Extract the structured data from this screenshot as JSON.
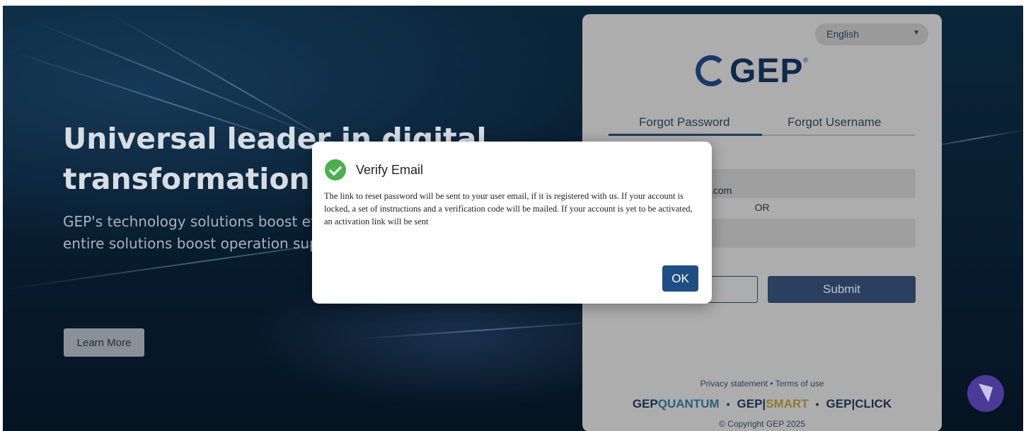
{
  "hero": {
    "headline": "Universal leader in digital transformation",
    "subtext": "GEP's technology solutions boost efficiency and provide real-time entire solutions boost operation supply chain...",
    "learn_more_label": "Learn More"
  },
  "card": {
    "language": "English",
    "logo_text": "GEP",
    "logo_mark": "®",
    "tabs": [
      {
        "label": "Forgot Password",
        "active": true
      },
      {
        "label": "Forgot Username",
        "active": false
      }
    ],
    "email_partial": ".com",
    "or_label": "OR",
    "submit_label": "Submit",
    "links": {
      "privacy": "Privacy statement",
      "separator": "•",
      "terms": "Terms of use"
    },
    "brands": {
      "quantum_gep": "GEP",
      "quantum": "QUANTUM",
      "smart_gep": "GEP",
      "smart": "SMART",
      "click_gep": "GEP",
      "click": "CLICK",
      "separator": "•",
      "divider": "|"
    },
    "copyright": "© Copyright GEP 2025"
  },
  "modal": {
    "title": "Verify Email",
    "body": "The link to reset password will be sent to your user email, if it is registered with us. If your account is locked, a set of instructions and a verification code will be mailed. If your account is yet to be activated, an activation link will be sent",
    "ok_label": "OK"
  },
  "icons": {
    "check": "check-circle-icon",
    "caret": "chevron-down-icon",
    "help": "chat-help-icon"
  },
  "colors": {
    "primary": "#1f4e85",
    "success": "#4caf50",
    "submit": "#2b3f5f",
    "help_bubble": "#4a3b98"
  }
}
